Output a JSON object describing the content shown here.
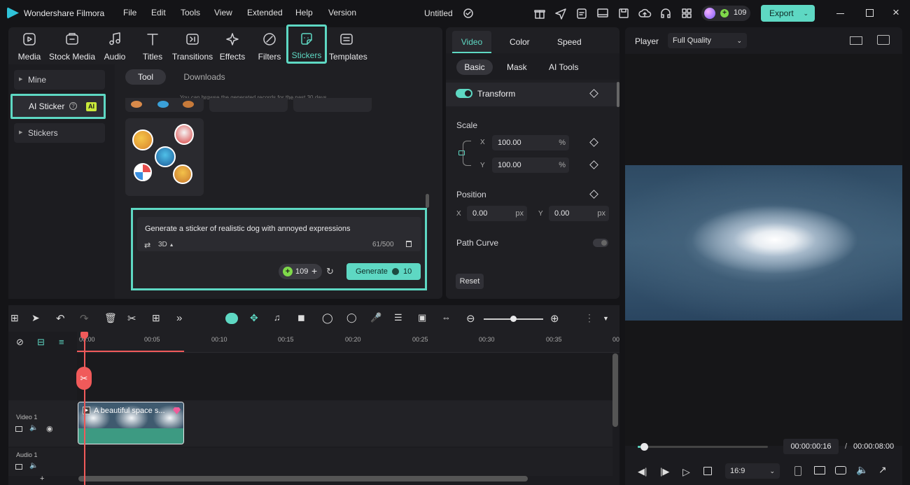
{
  "app": {
    "name": "Wondershare Filmora",
    "project": "Untitled",
    "credits": "109",
    "export": "Export"
  },
  "menu": [
    "File",
    "Edit",
    "Tools",
    "View",
    "Extended",
    "Help",
    "Version"
  ],
  "tabs": [
    "Media",
    "Stock Media",
    "Audio",
    "Titles",
    "Transitions",
    "Effects",
    "Filters",
    "Stickers",
    "Templates"
  ],
  "sidebar": {
    "mine": "Mine",
    "ai_sticker": "AI Sticker",
    "ai_badge": "AI",
    "stickers": "Stickers"
  },
  "subtabs": {
    "tool": "Tool",
    "downloads": "Downloads"
  },
  "hint": "You can browse the generated records for the past 30 days.",
  "prompt": {
    "text": "Generate a sticker of realistic dog with annoyed expressions",
    "style": "3D",
    "count": "61/500",
    "credits": "109",
    "generate": "Generate",
    "cost": "10"
  },
  "props": {
    "tabs": [
      "Video",
      "Color",
      "Speed"
    ],
    "subtabs": [
      "Basic",
      "Mask",
      "AI Tools"
    ],
    "transform": "Transform",
    "scale": "Scale",
    "x": "X",
    "y": "Y",
    "scale_x": "100.00",
    "scale_y": "100.00",
    "pct": "%",
    "position": "Position",
    "pos_x": "0.00",
    "pos_y": "0.00",
    "px": "px",
    "path_curve": "Path Curve",
    "reset": "Reset"
  },
  "player": {
    "label": "Player",
    "quality": "Full Quality",
    "current": "00:00:00:16",
    "sep": "/",
    "total": "00:00:08:00",
    "ratio": "16:9",
    "progress": 0.02
  },
  "timeline": {
    "ticks": [
      "00:00",
      "00:05",
      "00:10",
      "00:15",
      "00:20",
      "00:25",
      "00:30",
      "00:35",
      "00:"
    ],
    "video_track": "Video 1",
    "audio_track": "Audio 1",
    "clip_title": "A beautiful space s..."
  },
  "colors": {
    "accent": "#5ed8c3",
    "playhead": "#f05a5a",
    "clip": "#3d9a82"
  }
}
